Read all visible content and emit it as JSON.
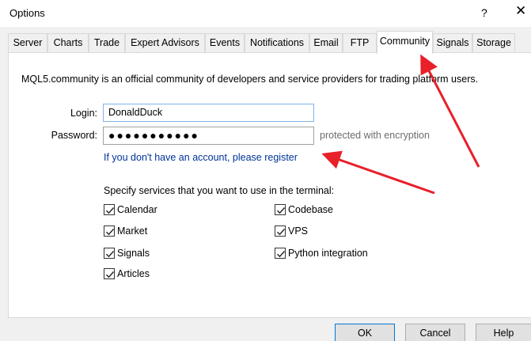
{
  "window": {
    "title": "Options",
    "help_glyph": "?",
    "close_glyph": "✕"
  },
  "tabs": [
    {
      "label": "Server"
    },
    {
      "label": "Charts"
    },
    {
      "label": "Trade"
    },
    {
      "label": "Expert Advisors"
    },
    {
      "label": "Events"
    },
    {
      "label": "Notifications"
    },
    {
      "label": "Email"
    },
    {
      "label": "FTP"
    },
    {
      "label": "Community",
      "active": true
    },
    {
      "label": "Signals"
    },
    {
      "label": "Storage"
    }
  ],
  "community": {
    "intro": "MQL5.community is an official community of developers and service providers for trading platform users.",
    "login_label": "Login:",
    "login_value": "DonaldDuck",
    "password_label": "Password:",
    "password_value": "●●●●●●●●●●●",
    "encryption_note": "protected with encryption",
    "register_link": "If you don't have an account, please register",
    "services_label": "Specify services that you want to use in the terminal:",
    "services": [
      {
        "label": "Calendar",
        "checked": true
      },
      {
        "label": "Market",
        "checked": true
      },
      {
        "label": "Signals",
        "checked": true
      },
      {
        "label": "Articles",
        "checked": true
      },
      {
        "label": "Codebase",
        "checked": true
      },
      {
        "label": "VPS",
        "checked": true
      },
      {
        "label": "Python integration",
        "checked": true
      }
    ]
  },
  "buttons": {
    "ok": "OK",
    "cancel": "Cancel",
    "help": "Help"
  },
  "colors": {
    "annotation_arrow": "#e8202a",
    "link": "#003399",
    "focus_border": "#0078d7"
  }
}
